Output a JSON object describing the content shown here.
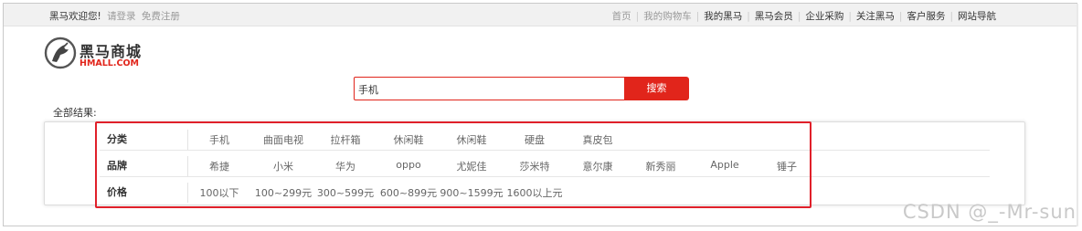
{
  "topbar": {
    "welcome": "黑马欢迎您!",
    "login": "请登录",
    "register": "免费注册",
    "nav": [
      {
        "label": "首页",
        "muted": true
      },
      {
        "label": "我的购物车",
        "muted": true
      },
      {
        "label": "我的黑马",
        "muted": false
      },
      {
        "label": "黑马会员",
        "muted": false
      },
      {
        "label": "企业采购",
        "muted": false
      },
      {
        "label": "关注黑马",
        "muted": false
      },
      {
        "label": "客户服务",
        "muted": false
      },
      {
        "label": "网站导航",
        "muted": false
      }
    ]
  },
  "logo": {
    "title": "黑马商城",
    "subtitle": "HMALL.COM"
  },
  "search": {
    "value": "手机",
    "button": "搜索"
  },
  "results_label": "全部结果:",
  "filters": [
    {
      "label": "分类",
      "options": [
        "手机",
        "曲面电视",
        "拉杆箱",
        "休闲鞋",
        "休闲鞋",
        "硬盘",
        "真皮包"
      ]
    },
    {
      "label": "品牌",
      "options": [
        "希捷",
        "小米",
        "华为",
        "oppo",
        "尤妮佳",
        "莎米特",
        "意尔康",
        "新秀丽",
        "Apple",
        "锤子"
      ]
    },
    {
      "label": "价格",
      "options": [
        "100以下",
        "100~299元",
        "300~599元",
        "600~899元",
        "900~1599元",
        "1600以上元"
      ]
    }
  ],
  "watermark": "CSDN @_-Mr-sun",
  "colors": {
    "accent": "#e1251b",
    "highlight": "#e0202a"
  }
}
